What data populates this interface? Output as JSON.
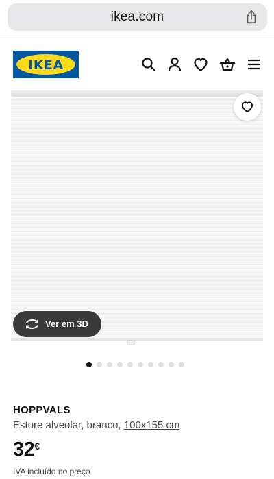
{
  "browser": {
    "url": "ikea.com"
  },
  "header": {
    "logo_text": "IKEA",
    "icons": [
      "search-icon",
      "account-icon",
      "heart-icon",
      "basket-icon",
      "menu-icon"
    ]
  },
  "gallery": {
    "view3d_label": "Ver em 3D",
    "image_count": 10,
    "active_index": 0
  },
  "product": {
    "name": "HOPPVALS",
    "description": "Estore alveolar, branco, ",
    "size": "100x155 cm",
    "price_int": "32",
    "currency": "€",
    "vat_note": "IVA incluído no preço"
  },
  "colors": {
    "ikea_blue": "#0058a3",
    "ikea_yellow": "#ffda1a",
    "button_dark": "#3a3a3a"
  }
}
